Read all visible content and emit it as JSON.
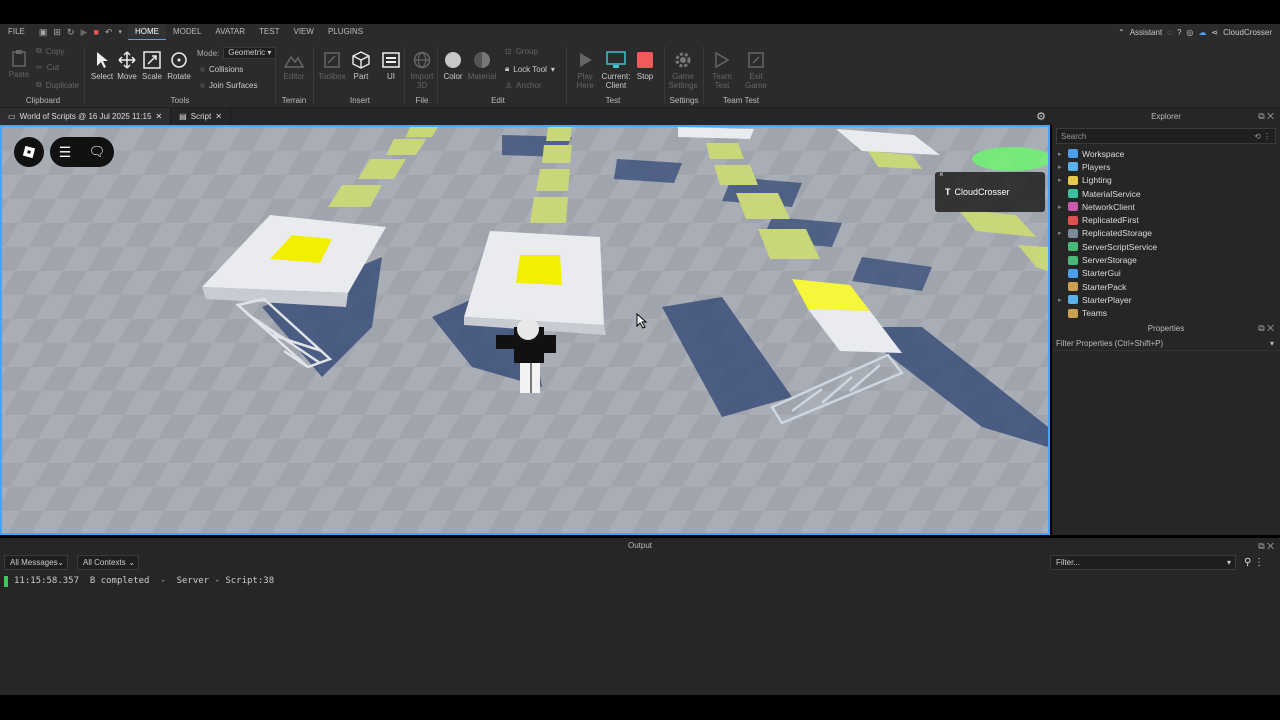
{
  "menu": {
    "file": "FILE",
    "tabs": [
      "HOME",
      "MODEL",
      "AVATAR",
      "TEST",
      "VIEW",
      "PLUGINS"
    ],
    "active": "HOME"
  },
  "topright": {
    "assistant": "Assistant",
    "user": "CloudCrosser"
  },
  "ribbon": {
    "clipboard": {
      "paste": "Paste",
      "copy": "Copy",
      "cut": "Cut",
      "duplicate": "Duplicate",
      "group": "Clipboard"
    },
    "tools": {
      "select": "Select",
      "move": "Move",
      "scale": "Scale",
      "rotate": "Rotate",
      "mode_label": "Mode:",
      "mode_value": "Geometric",
      "collisions": "Collisions",
      "join_surfaces": "Join Surfaces",
      "group": "Tools"
    },
    "terrain": {
      "editor": "Editor",
      "group": "Terrain"
    },
    "insert": {
      "toolbox": "Toolbox",
      "part": "Part",
      "ui": "UI",
      "group": "Insert"
    },
    "file": {
      "import3d": "Import 3D",
      "group": "File"
    },
    "edit": {
      "color": "Color",
      "material": "Material",
      "group_btn": "Group",
      "lock_tool": "Lock Tool",
      "anchor": "Anchor",
      "group": "Edit"
    },
    "test": {
      "play_here": "Play Here",
      "current": "Current: Client",
      "stop": "Stop",
      "group": "Test"
    },
    "settings": {
      "game_settings": "Game Settings",
      "group": "Settings"
    },
    "teamtest": {
      "team_test": "Team Test",
      "exit_game": "Exit Game",
      "group": "Team Test"
    }
  },
  "doctabs": [
    {
      "label": "World of Scripts @ 16 Jul 2025 11:15"
    },
    {
      "label": "Script"
    }
  ],
  "viewport": {
    "nametag": "CloudCrosser"
  },
  "explorer": {
    "title": "Explorer",
    "search_placeholder": "Search",
    "items": [
      {
        "label": "Workspace",
        "color": "#4a9fe8",
        "expand": true
      },
      {
        "label": "Players",
        "color": "#5ab0e8",
        "expand": true
      },
      {
        "label": "Lighting",
        "color": "#e8c84a",
        "expand": true
      },
      {
        "label": "MaterialService",
        "color": "#3cc0a0",
        "expand": false
      },
      {
        "label": "NetworkClient",
        "color": "#c85ab0",
        "expand": true
      },
      {
        "label": "ReplicatedFirst",
        "color": "#e05050",
        "expand": false
      },
      {
        "label": "ReplicatedStorage",
        "color": "#7a8a9a",
        "expand": true
      },
      {
        "label": "ServerScriptService",
        "color": "#4ab878",
        "expand": false
      },
      {
        "label": "ServerStorage",
        "color": "#4ab878",
        "expand": false
      },
      {
        "label": "StarterGui",
        "color": "#4a9fe8",
        "expand": false
      },
      {
        "label": "StarterPack",
        "color": "#c8a050",
        "expand": false
      },
      {
        "label": "StarterPlayer",
        "color": "#5ab0e8",
        "expand": true
      },
      {
        "label": "Teams",
        "color": "#c8a050",
        "expand": false
      }
    ]
  },
  "properties": {
    "title": "Properties",
    "filter": "Filter Properties (Ctrl+Shift+P)"
  },
  "output": {
    "title": "Output",
    "messages_filter": "All Messages",
    "contexts_filter": "All Contexts",
    "filter_placeholder": "Filter...",
    "log": {
      "time": "11:15:58.357",
      "text": "B completed",
      "source": "Server - Script:38"
    }
  }
}
